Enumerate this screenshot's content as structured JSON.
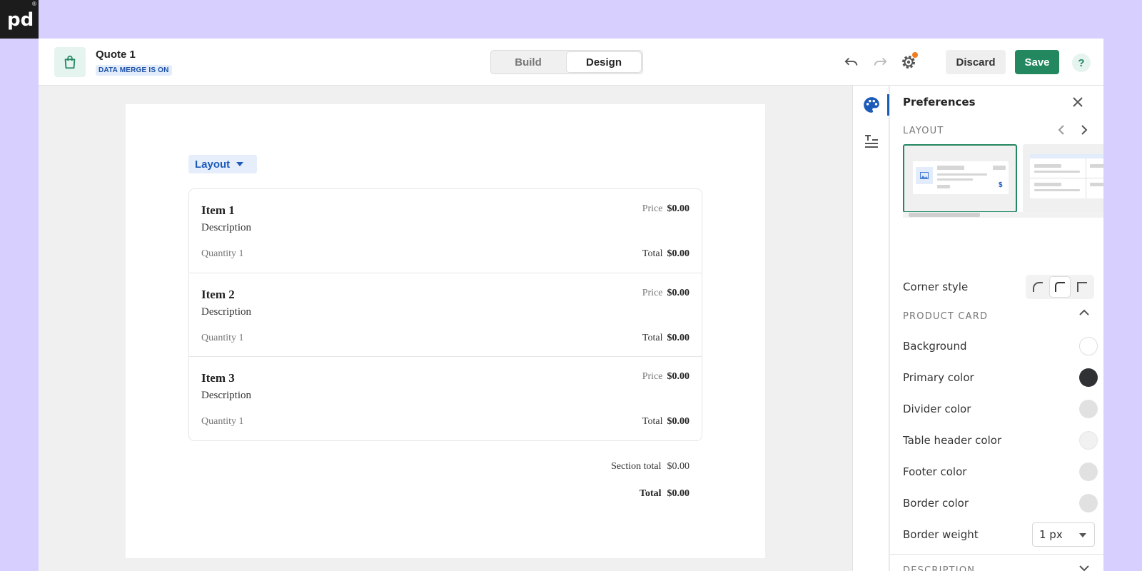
{
  "brand": {
    "logo_text": "pd",
    "logo_mark": "®"
  },
  "header": {
    "doc_title": "Quote 1",
    "badge": "DATA MERGE IS ON",
    "mode_tabs": [
      {
        "label": "Build",
        "active": false
      },
      {
        "label": "Design",
        "active": true
      }
    ],
    "discard_label": "Discard",
    "save_label": "Save",
    "help_label": "?"
  },
  "content": {
    "layout_button": "Layout",
    "items": [
      {
        "title": "Item 1",
        "description": "Description",
        "price_label": "Price",
        "price": "$0.00",
        "quantity": "Quantity 1",
        "total_label": "Total",
        "total": "$0.00"
      },
      {
        "title": "Item 2",
        "description": "Description",
        "price_label": "Price",
        "price": "$0.00",
        "quantity": "Quantity 1",
        "total_label": "Total",
        "total": "$0.00"
      },
      {
        "title": "Item 3",
        "description": "Description",
        "price_label": "Price",
        "price": "$0.00",
        "quantity": "Quantity 1",
        "total_label": "Total",
        "total": "$0.00"
      }
    ],
    "section_total_label": "Section total",
    "section_total": "$0.00",
    "total_label": "Total",
    "total": "$0.00"
  },
  "panel": {
    "title": "Preferences",
    "layout_heading": "LAYOUT",
    "corner_style_label": "Corner style",
    "corner_options": [
      "rounded",
      "medium",
      "square"
    ],
    "corner_selected": 1,
    "product_card_heading": "PRODUCT CARD",
    "colors": [
      {
        "label": "Background",
        "color": "#ffffff"
      },
      {
        "label": "Primary color",
        "color": "#2f3135"
      },
      {
        "label": "Divider color",
        "color": "#e1e1e1"
      },
      {
        "label": "Table header color",
        "color": "#f1f1f1"
      },
      {
        "label": "Footer color",
        "color": "#e1e1e1"
      },
      {
        "label": "Border color",
        "color": "#e1e1e1"
      }
    ],
    "border_weight_label": "Border weight",
    "border_weight_value": "1 px",
    "description_heading": "DESCRIPTION"
  },
  "theme": {
    "accent_green": "#238760",
    "accent_blue": "#1c5bb8",
    "notification_dot": "#f07c1e"
  }
}
